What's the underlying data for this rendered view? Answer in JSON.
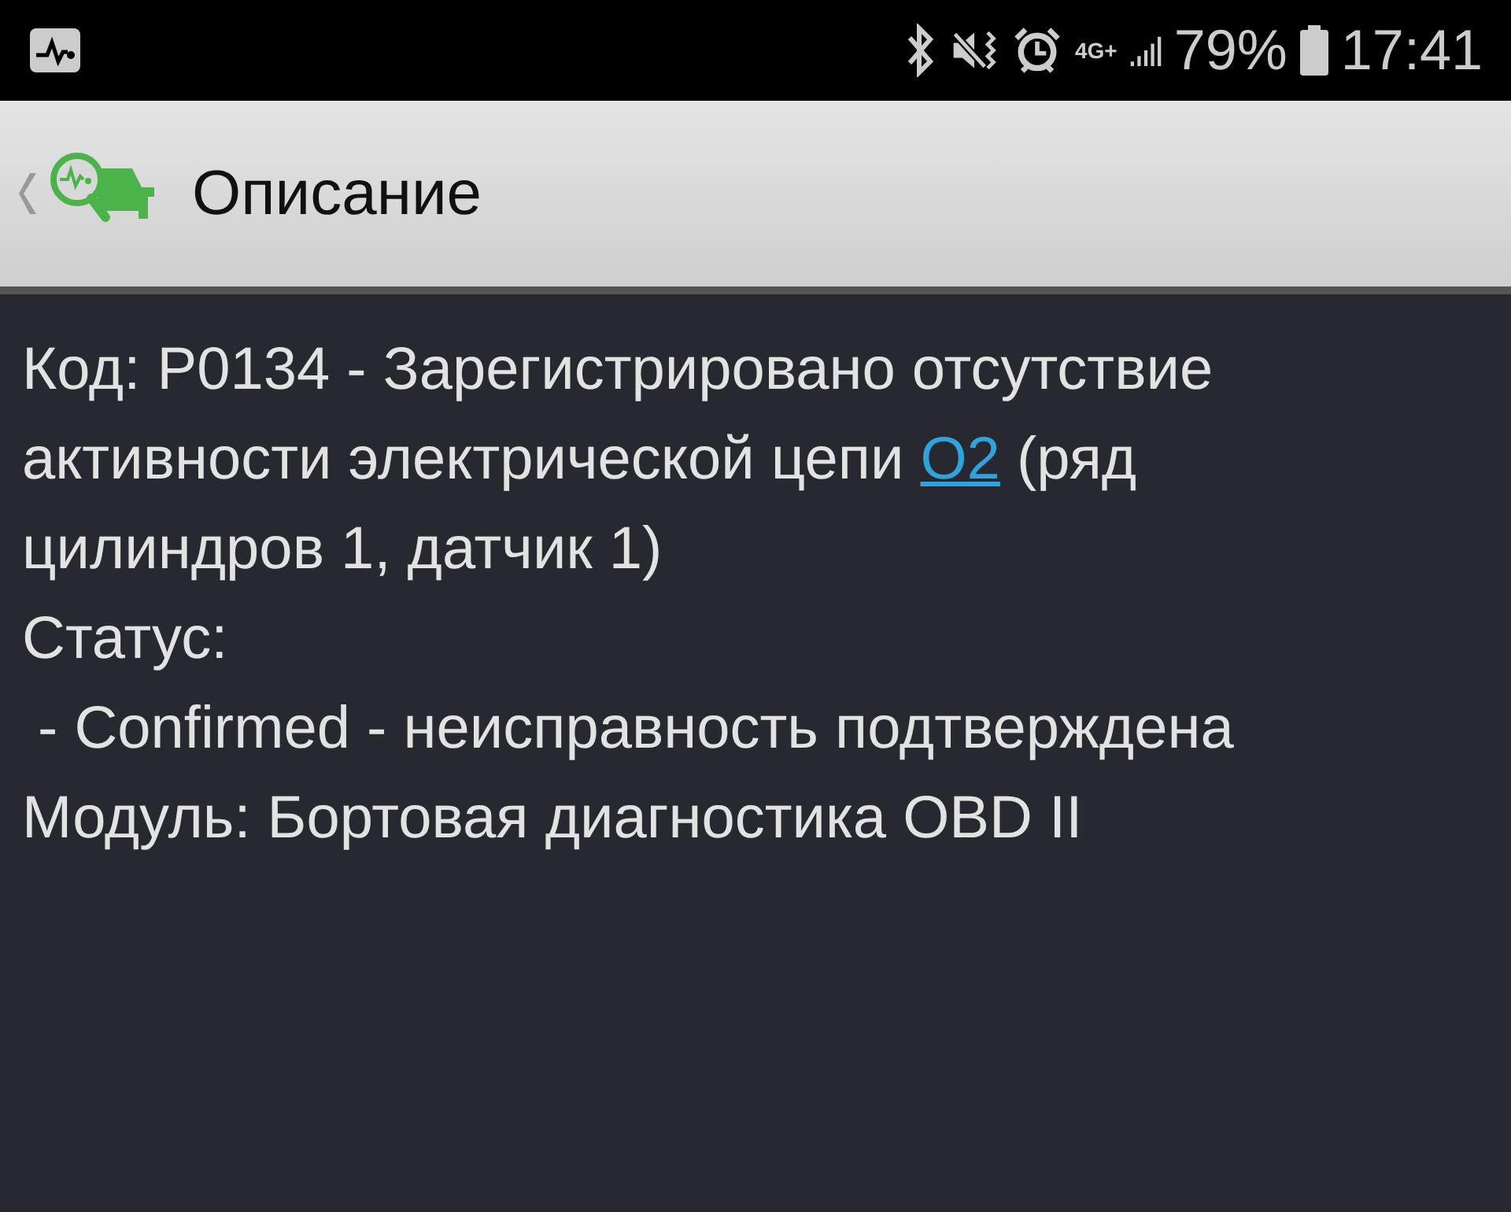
{
  "status_bar": {
    "network": "4G+",
    "battery": "79%",
    "time": "17:41"
  },
  "header": {
    "title": "Описание"
  },
  "description": {
    "text_before": "Код: P0134 - Зарегистрировано отсутствие активности электрической цепи ",
    "link": "O2",
    "text_after": " (ряд цилиндров 1, датчик 1)"
  },
  "status": {
    "label": "Статус:",
    "value": "- Confirmed - неисправность подтверждена"
  },
  "module": "Модуль: Бортовая диагностика OBD II"
}
